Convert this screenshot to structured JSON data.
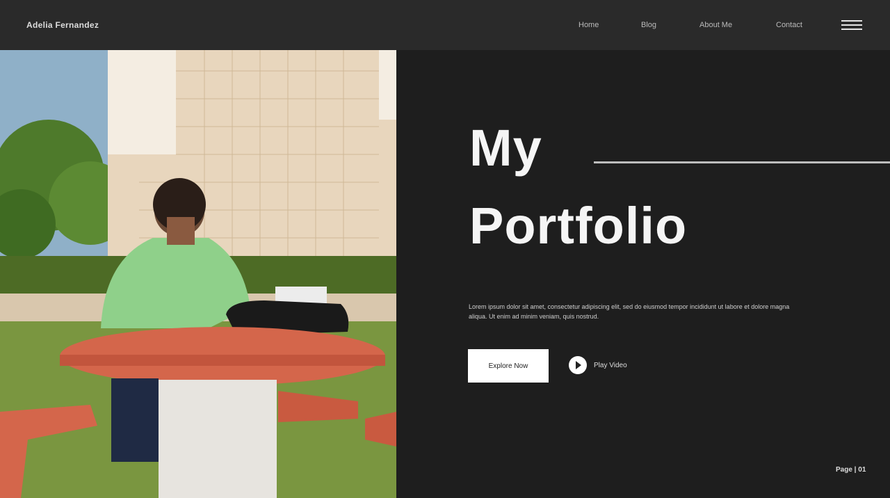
{
  "header": {
    "brand": "Adelia Fernandez",
    "nav": [
      "Home",
      "Blog",
      "About Me",
      "Contact"
    ]
  },
  "hero": {
    "title_line1": "My",
    "title_line2": "Portfolio",
    "description": "Lorem ipsum dolor sit amet, consectetur adipiscing elit, sed do eiusmod tempor incididunt ut labore et dolore magna aliqua. Ut enim ad minim veniam, quis nostrud.",
    "primary_button": "Explore Now",
    "play_label": "Play Video",
    "pager": "Page | 01"
  },
  "colors": {
    "background": "#1e1e1e",
    "topbar": "#2a2a2a",
    "text": "#f5f5f5"
  }
}
